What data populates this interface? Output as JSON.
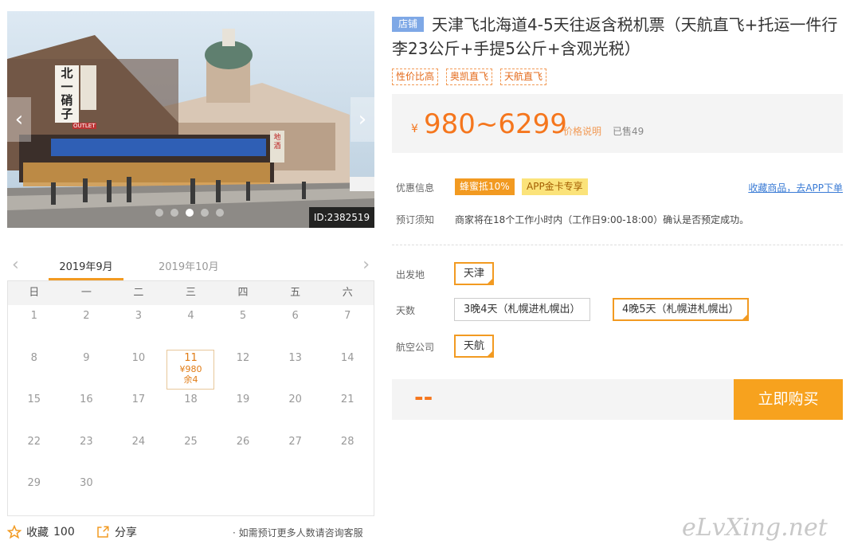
{
  "carousel": {
    "photo_id": "ID:2382519",
    "sign_main": "北一硝子",
    "sign_outlet": "OUTLET",
    "sign_shop": "地酒",
    "dots_count": 5,
    "active_dot": 2
  },
  "calendar": {
    "month_current": "2019年9月",
    "month_next": "2019年10月",
    "weekdays": [
      "日",
      "一",
      "二",
      "三",
      "四",
      "五",
      "六"
    ],
    "weeks": [
      [
        "1",
        "2",
        "3",
        "4",
        "5",
        "6",
        "7"
      ],
      [
        "8",
        "9",
        "10",
        "11",
        "12",
        "13",
        "14"
      ],
      [
        "15",
        "16",
        "17",
        "18",
        "19",
        "20",
        "21"
      ],
      [
        "22",
        "23",
        "24",
        "25",
        "26",
        "27",
        "28"
      ],
      [
        "29",
        "30",
        "",
        "",
        "",
        "",
        ""
      ]
    ],
    "highlight_day": "11",
    "highlight_price": "¥980",
    "highlight_remaining": "余4"
  },
  "footer": {
    "favorite_label": "收藏",
    "favorite_count": "100",
    "share_label": "分享",
    "consult_text": "· 如需预订更多人数请咨询客服"
  },
  "product": {
    "shop_badge": "店铺",
    "title": "天津飞北海道4-5天往返含税机票（天航直飞+托运一件行李23公斤+手提5公斤+含观光税）",
    "tags": [
      "性价比高",
      "奥凯直飞",
      "天航直飞"
    ]
  },
  "price": {
    "currency": "¥",
    "range": "980~6299",
    "note": "价格说明",
    "sold": "已售49"
  },
  "promo": {
    "label": "优惠信息",
    "badges": [
      "蜂蜜抵10%",
      "APP金卡专享"
    ],
    "app_link": "收藏商品，去APP下单"
  },
  "booking_notice": {
    "label": "预订须知",
    "text": "商家将在18个工作小时内（工作日9:00-18:00）确认是否预定成功。"
  },
  "options": {
    "departure_label": "出发地",
    "departure": "天津",
    "days_label": "天数",
    "days": [
      "3晚4天（札幌进札幌出）",
      "4晚5天（札幌进札幌出）"
    ],
    "airline_label": "航空公司",
    "airline": "天航"
  },
  "buy": {
    "total_placeholder": "--",
    "button_label": "立即购买"
  },
  "watermark": "eLvXing.net",
  "colors": {
    "accent_orange": "#f29a21",
    "price_orange": "#f5761d",
    "link_blue": "#3a7bd5",
    "badge_blue": "#7ea8e6"
  }
}
